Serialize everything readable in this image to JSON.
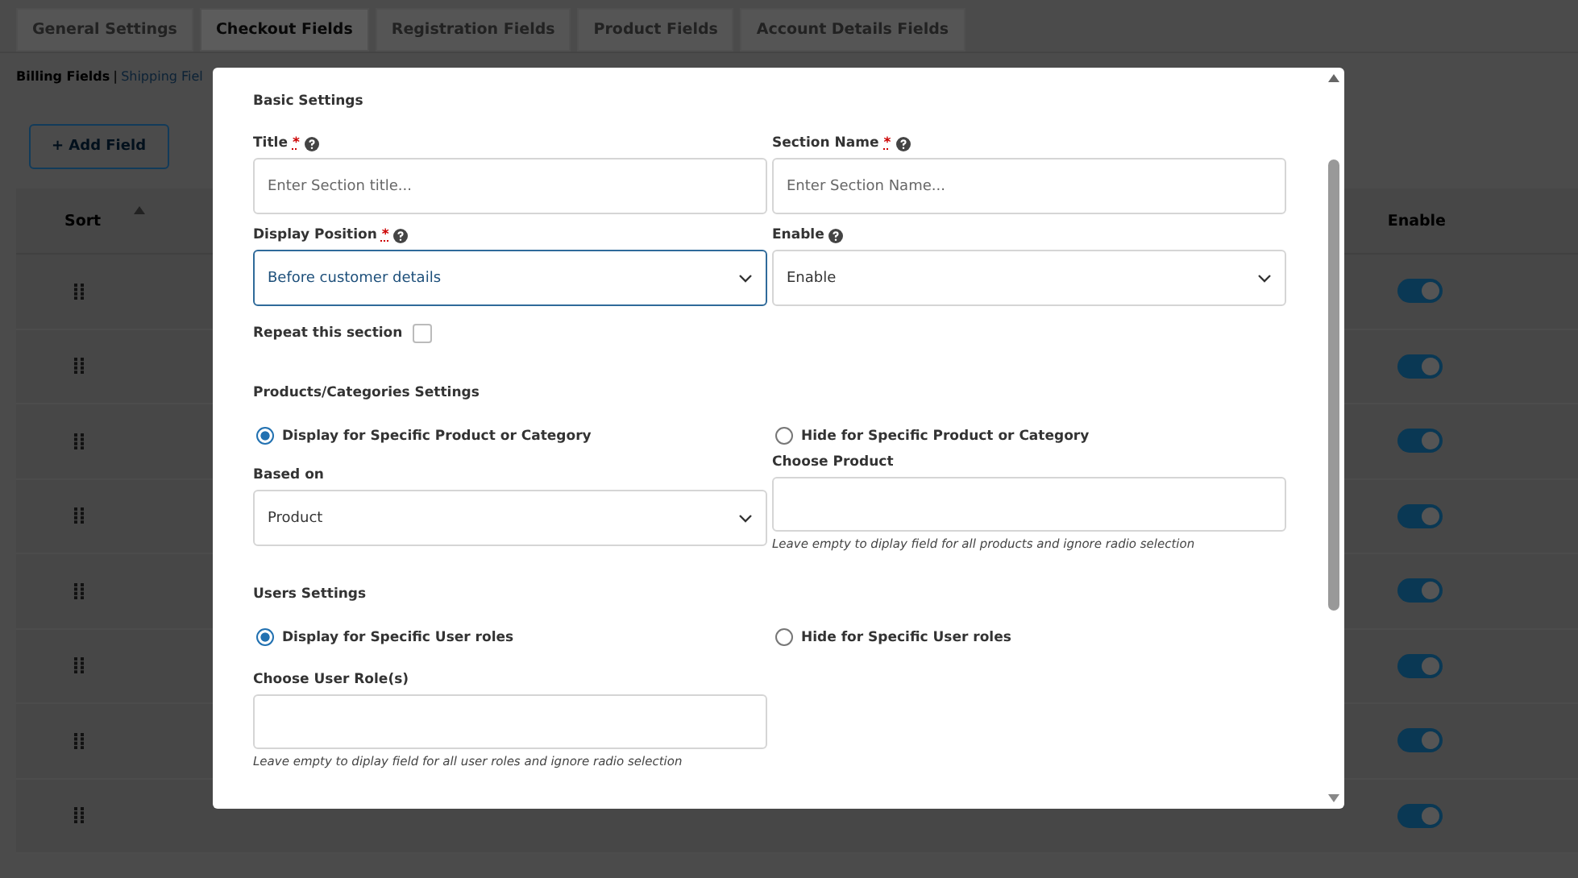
{
  "tabs": [
    {
      "label": "General Settings",
      "selected": false
    },
    {
      "label": "Checkout Fields",
      "selected": true
    },
    {
      "label": "Registration Fields",
      "selected": false
    },
    {
      "label": "Product Fields",
      "selected": false
    },
    {
      "label": "Account Details Fields",
      "selected": false
    }
  ],
  "subnav": {
    "links": [
      {
        "label": "Billing Fields",
        "selected": true
      },
      {
        "label": "Shipping Fiel",
        "selected": false
      }
    ],
    "separator": "|"
  },
  "add_button": "+ Add Field",
  "table": {
    "columns": [
      {
        "label": "Sort",
        "sortable": true
      },
      {
        "label": "Enable",
        "sortable": false
      }
    ],
    "rows": [
      {
        "enabled": true
      },
      {
        "enabled": true
      },
      {
        "enabled": true
      },
      {
        "enabled": true
      },
      {
        "enabled": true
      },
      {
        "enabled": true
      },
      {
        "enabled": true
      },
      {
        "enabled": true
      }
    ]
  },
  "modal": {
    "basic": {
      "heading": "Basic Settings",
      "fields": [
        {
          "kind": "text",
          "label": "Title",
          "required_mark": "*",
          "placeholder": "Enter Section title..."
        },
        {
          "kind": "text",
          "label": "Section Name",
          "required_mark": "*",
          "placeholder": "Enter Section Name..."
        },
        {
          "kind": "select",
          "label": "Display Position",
          "required_mark": "*",
          "value": "Before customer details",
          "focused": true
        },
        {
          "kind": "select",
          "label": "Enable",
          "value": "Enable",
          "focused": false
        }
      ],
      "repeat": {
        "label": "Repeat this section",
        "checked": false
      }
    },
    "products": {
      "heading": "Products/Categories Settings",
      "radios": [
        {
          "label": "Display for Specific Product or Category",
          "selected": true
        },
        {
          "label": "Hide for Specific Product or Category",
          "selected": false
        }
      ],
      "based_on": {
        "label": "Based on",
        "value": "Product"
      },
      "choose": {
        "label": "Choose Product",
        "hint": "Leave empty to diplay field for all products and ignore radio selection"
      }
    },
    "users": {
      "heading": "Users Settings",
      "radios": [
        {
          "label": "Display for Specific User roles",
          "selected": true
        },
        {
          "label": "Hide for Specific User roles",
          "selected": false
        }
      ],
      "choose": {
        "label": "Choose User Role(s)",
        "hint": "Leave empty to diplay field for all user roles and ignore radio selection"
      }
    }
  }
}
